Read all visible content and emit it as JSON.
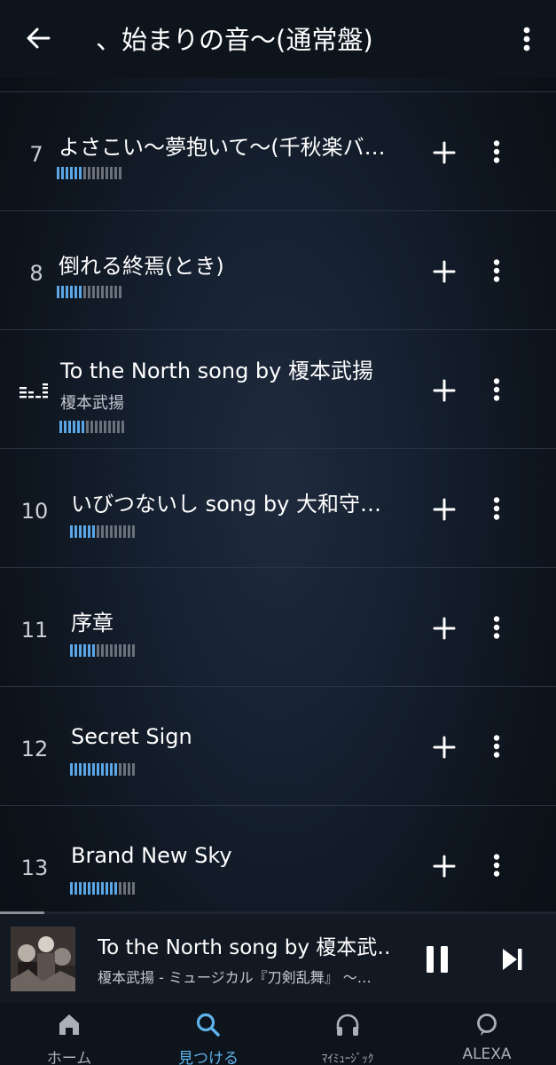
{
  "header": {
    "title": "、始まりの音～(通常盤)",
    "back_icon": "arrow-left-icon",
    "more_icon": "more-vertical-icon"
  },
  "tracks": [
    {
      "number": "7",
      "title": "よさこい～夢抱いて～(千秋楽バ…",
      "artist": "",
      "level": 0.4
    },
    {
      "number": "8",
      "title": "倒れる終焉(とき)",
      "artist": "",
      "level": 0.4
    },
    {
      "number": "",
      "title": "To the North song by 榎本武揚",
      "artist": "榎本武揚",
      "level": 0.4,
      "playing": true
    },
    {
      "number": "10",
      "title": "いびつないし song by 大和守…",
      "artist": "",
      "level": 0.4
    },
    {
      "number": "11",
      "title": "序章",
      "artist": "",
      "level": 0.4
    },
    {
      "number": "12",
      "title": "Secret Sign",
      "artist": "",
      "level": 0.75
    },
    {
      "number": "13",
      "title": "Brand New Sky",
      "artist": "",
      "level": 0.75
    }
  ],
  "now_playing": {
    "title": "To the North song by 榎本武…",
    "subtitle": "榎本武揚 - ミュージカル『刀剣乱舞』 ～…",
    "progress": 0.08,
    "pause_icon": "pause-icon",
    "next_icon": "skip-next-icon"
  },
  "nav": [
    {
      "label": "ホーム",
      "icon": "home-icon",
      "active": false
    },
    {
      "label": "見つける",
      "icon": "search-icon",
      "active": true
    },
    {
      "label": "ﾏｲﾐｭｰｼﾞｯｸ",
      "icon": "headphones-icon",
      "active": false
    },
    {
      "label": "ALEXA",
      "icon": "alexa-icon",
      "active": false
    }
  ],
  "colors": {
    "accent": "#5fb3ea",
    "meter_on": "#5aa6e6",
    "meter_off": "#6b717a"
  }
}
